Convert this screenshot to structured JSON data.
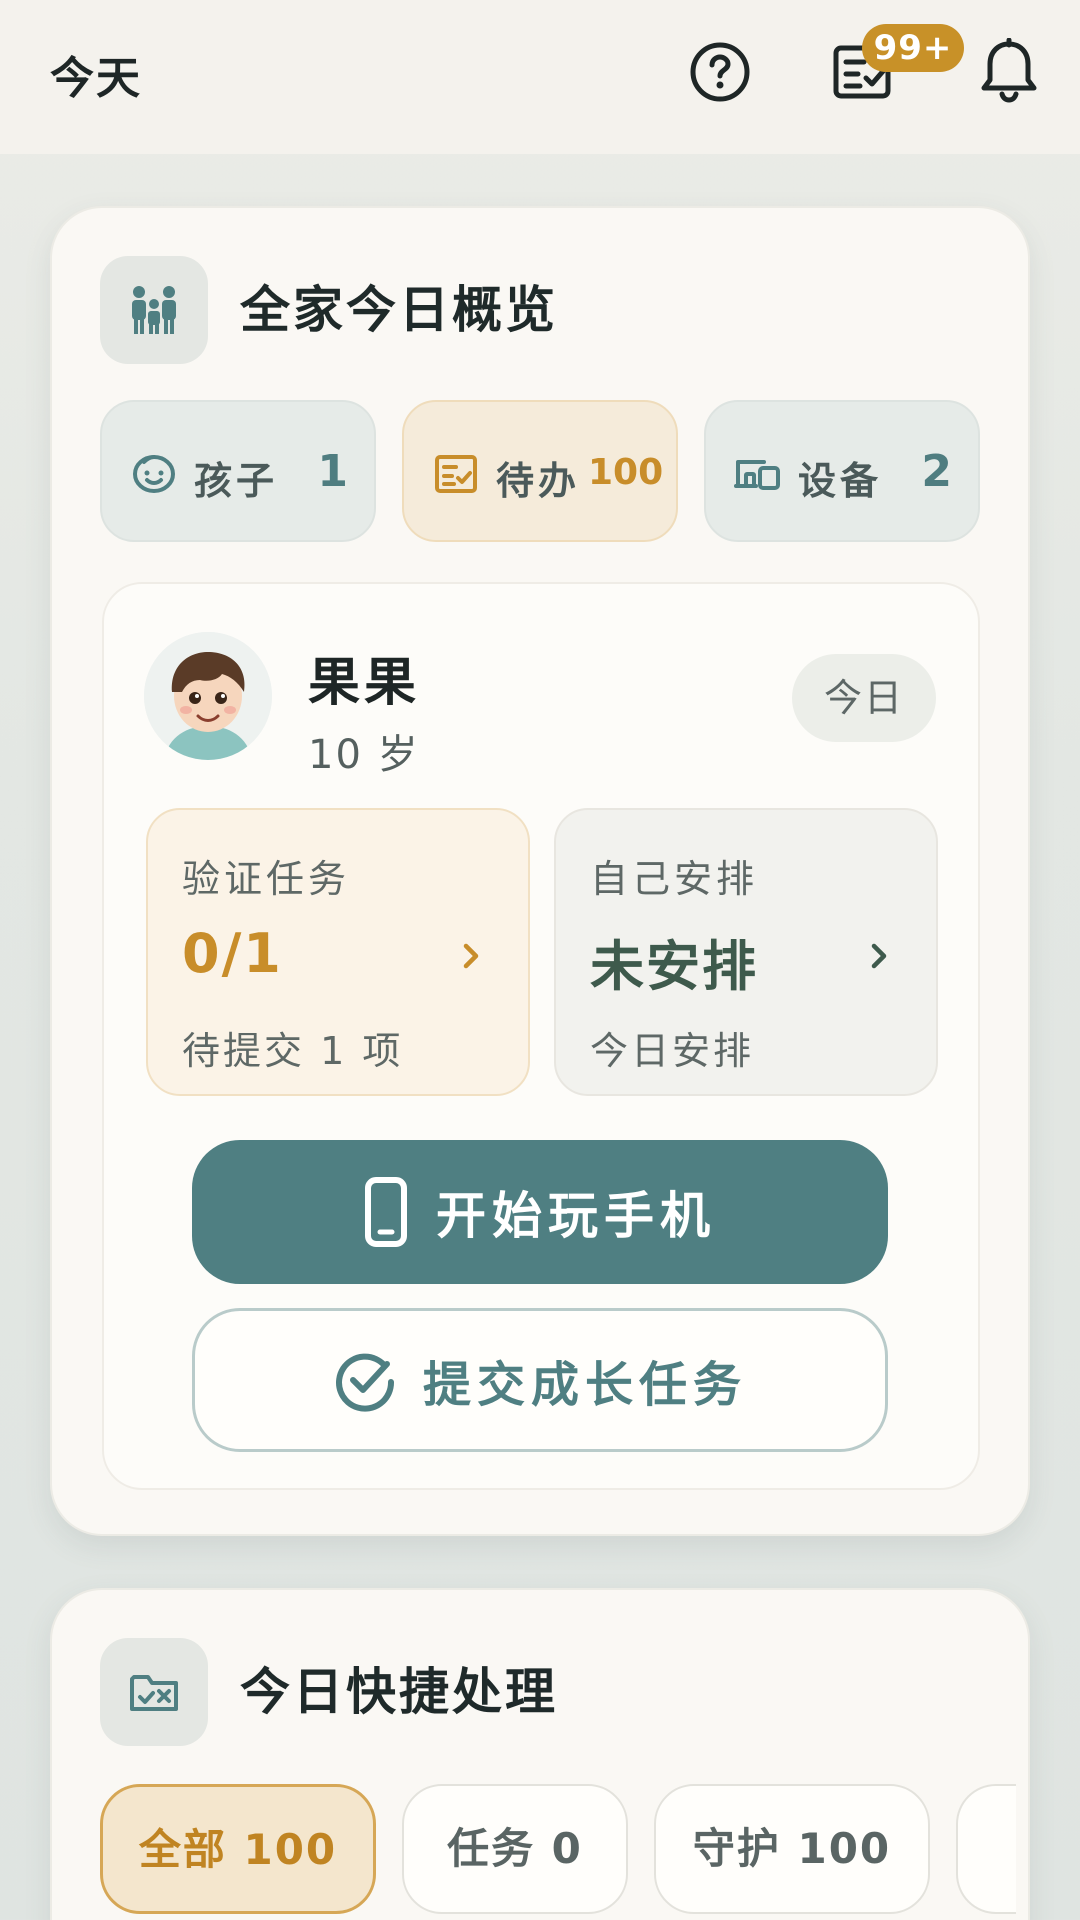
{
  "header": {
    "title": "今天",
    "tasks_badge": "99+"
  },
  "overview": {
    "title": "全家今日概览",
    "chips": {
      "kids": {
        "label": "孩子",
        "value": "1"
      },
      "todo": {
        "label": "待办",
        "value": "100"
      },
      "devices": {
        "label": "设备",
        "value": "2"
      }
    },
    "child": {
      "name": "果果",
      "age": "10 岁",
      "day_pill": "今日",
      "verify": {
        "label": "验证任务",
        "value": "0/1",
        "sub": "待提交 1 项"
      },
      "self_plan": {
        "label": "自己安排",
        "value": "未安排",
        "sub": "今日安排"
      },
      "primary_button": "开始玩手机",
      "secondary_button": "提交成长任务"
    }
  },
  "quick": {
    "title": "今日快捷处理",
    "filters": [
      {
        "label": "全部 100"
      },
      {
        "label": "任务 0"
      },
      {
        "label": "守护 100"
      }
    ]
  },
  "colors": {
    "accent_teal": "#4f7f82",
    "accent_gold": "#c88d2a",
    "badge": "#c89128"
  },
  "icons": {
    "help": "help-circle-icon",
    "tasks": "task-list-icon",
    "bell": "bell-icon",
    "family": "family-icon",
    "kids": "smile-face-icon",
    "todo": "checklist-icon",
    "devices": "devices-icon",
    "phone": "phone-icon",
    "check": "check-circle-icon",
    "folder": "folder-check-icon"
  }
}
